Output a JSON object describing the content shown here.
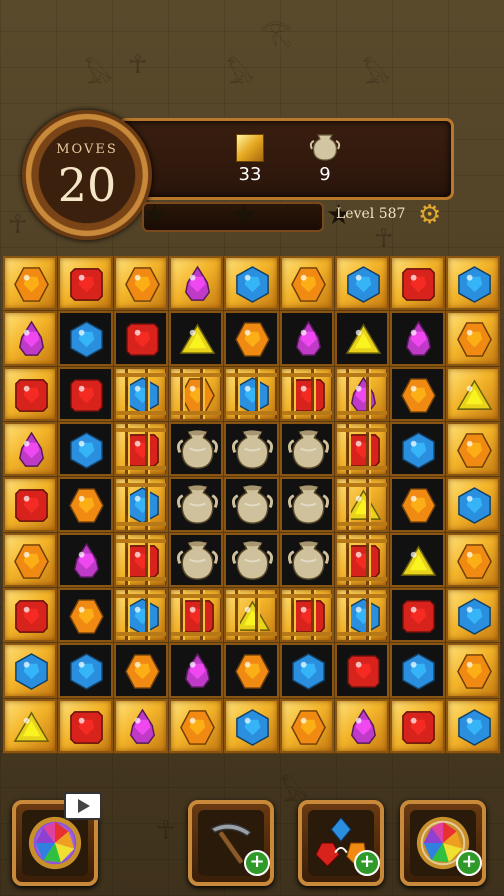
{
  "hud": {
    "moves_label": "MOVES",
    "moves_value": "20",
    "goals": [
      {
        "icon": "gold-tile-icon",
        "count": "33"
      },
      {
        "icon": "urn-icon",
        "count": "9"
      }
    ],
    "level_text": "Level 587",
    "stars_earned": 0,
    "stars_total": 3,
    "progress_fraction": 0.0
  },
  "board": {
    "rows": 9,
    "cols": 9,
    "cells": [
      [
        "orange",
        "red",
        "orange",
        "purple",
        "blue",
        "orange",
        "blue",
        "red",
        "blue"
      ],
      [
        "purple",
        "blue",
        "red",
        "yellow",
        "orange",
        "purple",
        "yellow",
        "purple",
        "orange"
      ],
      [
        "red",
        "red",
        "blue",
        "orange",
        "blue",
        "red",
        "purple",
        "orange",
        "yellow"
      ],
      [
        "purple",
        "blue",
        "red",
        "urn",
        "urn",
        "urn",
        "red",
        "blue",
        "orange"
      ],
      [
        "red",
        "orange",
        "blue",
        "urn",
        "urn",
        "urn",
        "yellow",
        "orange",
        "blue"
      ],
      [
        "orange",
        "purple",
        "red",
        "urn",
        "urn",
        "urn",
        "red",
        "yellow",
        "orange"
      ],
      [
        "red",
        "orange",
        "blue",
        "red",
        "yellow",
        "red",
        "blue",
        "red",
        "blue"
      ],
      [
        "blue",
        "blue",
        "orange",
        "purple",
        "orange",
        "blue",
        "red",
        "blue",
        "orange"
      ],
      [
        "yellow",
        "red",
        "purple",
        "orange",
        "blue",
        "orange",
        "purple",
        "red",
        "blue"
      ]
    ],
    "tile_bg": [
      [
        "gold",
        "gold",
        "gold",
        "gold",
        "gold",
        "gold",
        "gold",
        "gold",
        "gold"
      ],
      [
        "gold",
        "dark",
        "dark",
        "dark",
        "dark",
        "dark",
        "dark",
        "dark",
        "gold"
      ],
      [
        "gold",
        "dark",
        "gold",
        "gold",
        "gold",
        "gold",
        "gold",
        "dark",
        "gold"
      ],
      [
        "gold",
        "dark",
        "gold",
        "dark",
        "dark",
        "dark",
        "gold",
        "dark",
        "gold"
      ],
      [
        "gold",
        "dark",
        "gold",
        "dark",
        "dark",
        "dark",
        "gold",
        "dark",
        "gold"
      ],
      [
        "gold",
        "dark",
        "gold",
        "dark",
        "dark",
        "dark",
        "gold",
        "dark",
        "gold"
      ],
      [
        "gold",
        "dark",
        "gold",
        "gold",
        "gold",
        "gold",
        "gold",
        "dark",
        "gold"
      ],
      [
        "gold",
        "dark",
        "dark",
        "dark",
        "dark",
        "dark",
        "dark",
        "dark",
        "gold"
      ],
      [
        "gold",
        "gold",
        "gold",
        "gold",
        "gold",
        "gold",
        "gold",
        "gold",
        "gold"
      ]
    ],
    "caged": [
      [
        0,
        0,
        0,
        0,
        0,
        0,
        0,
        0,
        0
      ],
      [
        0,
        0,
        0,
        0,
        0,
        0,
        0,
        0,
        0
      ],
      [
        0,
        0,
        1,
        1,
        1,
        1,
        1,
        0,
        0
      ],
      [
        0,
        0,
        1,
        0,
        0,
        0,
        1,
        0,
        0
      ],
      [
        0,
        0,
        1,
        0,
        0,
        0,
        1,
        0,
        0
      ],
      [
        0,
        0,
        1,
        0,
        0,
        0,
        1,
        0,
        0
      ],
      [
        0,
        0,
        1,
        1,
        1,
        1,
        1,
        0,
        0
      ],
      [
        0,
        0,
        0,
        0,
        0,
        0,
        0,
        0,
        0
      ],
      [
        0,
        0,
        0,
        0,
        0,
        0,
        0,
        0,
        0
      ]
    ]
  },
  "colors": {
    "red": "#d8231c",
    "orange": "#f08a12",
    "blue": "#2b8fe0",
    "purple": "#c03ac8",
    "yellow": "#e8d21a",
    "frame_gold": "#c88a3a"
  },
  "boosters": [
    {
      "name": "rainbow-orb-booster",
      "icon": "rainbow-orb-icon",
      "badge": "video-ad-icon"
    },
    {
      "name": "pickaxe-booster",
      "icon": "pickaxe-icon",
      "badge": "plus-icon"
    },
    {
      "name": "shuffle-booster",
      "icon": "shuffle-gems-icon",
      "badge": "plus-icon"
    },
    {
      "name": "rainbow-orb-plus-booster",
      "icon": "rainbow-orb-icon",
      "badge": "plus-icon"
    }
  ]
}
